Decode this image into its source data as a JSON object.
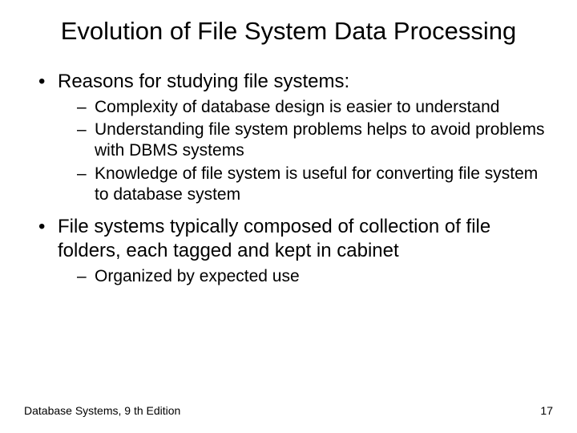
{
  "title": "Evolution of File System Data Processing",
  "bullets": [
    {
      "text": "Reasons for studying file systems:",
      "subs": [
        "Complexity of database design is easier to understand",
        "Understanding file system problems helps to avoid problems with DBMS systems",
        "Knowledge of file system is useful for converting file system to database system"
      ]
    },
    {
      "text": "File systems typically composed of collection of file folders, each tagged and kept in cabinet",
      "subs": [
        "Organized by expected use"
      ]
    }
  ],
  "footer": {
    "left": "Database Systems, 9 th Edition",
    "right": "17"
  }
}
